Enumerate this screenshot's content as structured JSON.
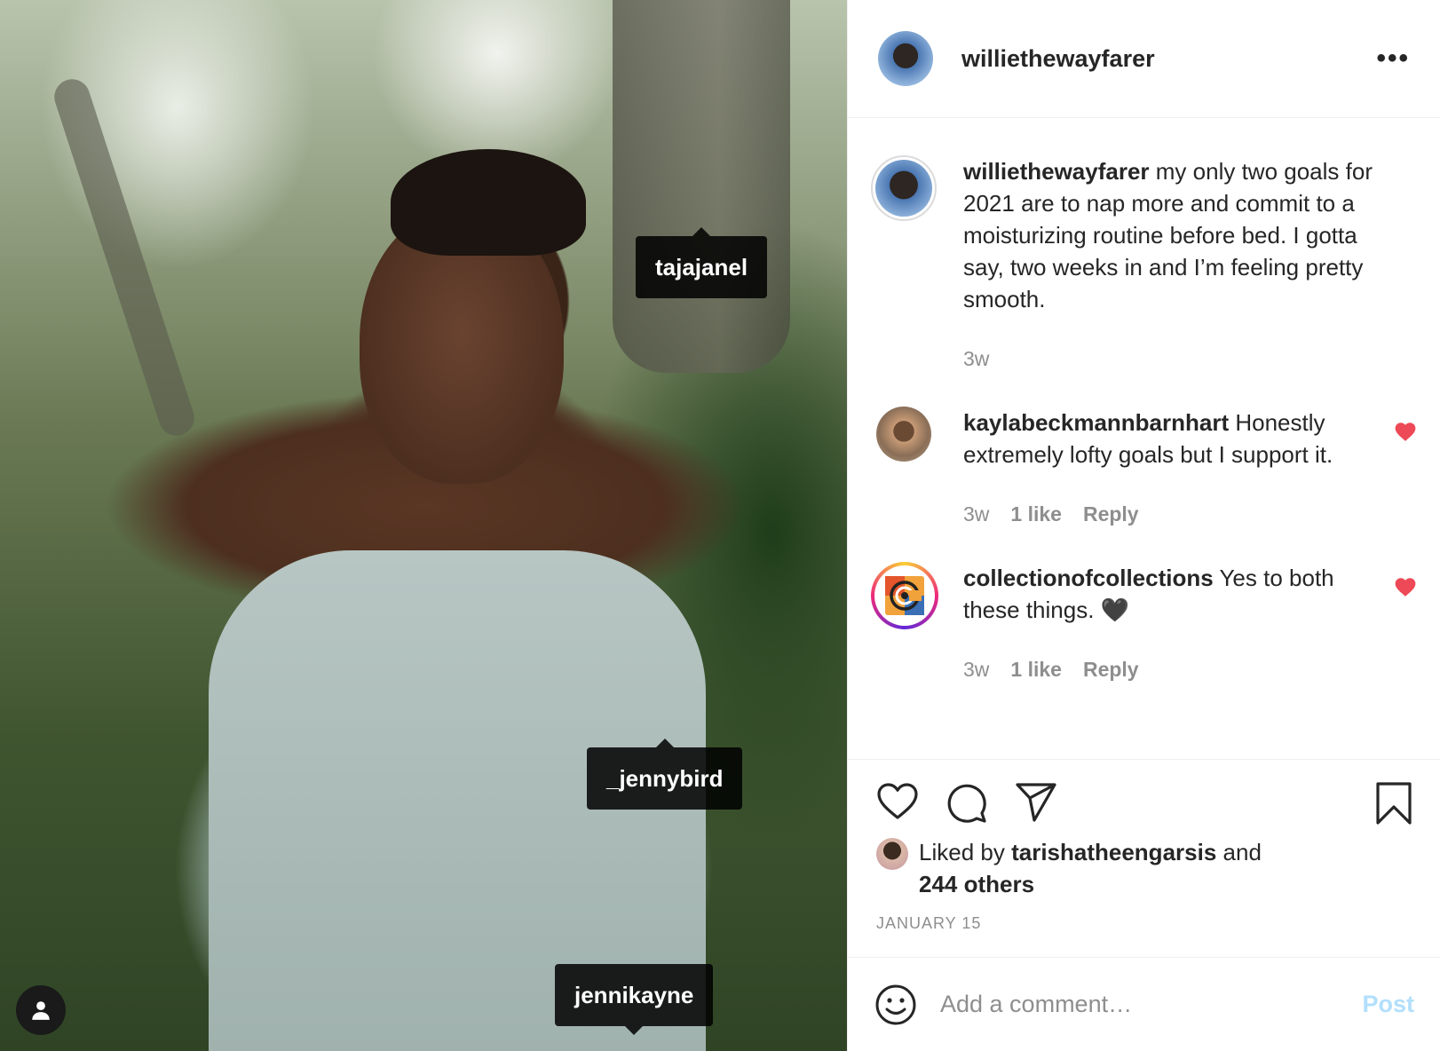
{
  "photo": {
    "tags": [
      {
        "label": "tajajanel"
      },
      {
        "label": "_jennybird"
      },
      {
        "label": "jennikayne"
      }
    ],
    "user_tags_icon": "person-icon"
  },
  "header": {
    "username": "williethewayfarer",
    "more_icon": "more-options-icon",
    "more_label": "•••"
  },
  "caption": {
    "username": "williethewayfarer",
    "text": " my only two goals for 2021 are to nap more and commit to a moisturizing routine before bed. I gotta say, two weeks in and I’m feeling pretty smooth.",
    "time": "3w"
  },
  "comments": [
    {
      "username": "kaylabeckmannbarnhart",
      "text": " Honestly extremely lofty goals but I support it.",
      "time": "3w",
      "likes": "1 like",
      "reply": "Reply",
      "liked": true
    },
    {
      "username": "collectionofcollections",
      "text": " Yes to both these things. 🖤",
      "time": "3w",
      "likes": "1 like",
      "reply": "Reply",
      "liked": true
    }
  ],
  "actions": {
    "icons": [
      "heart-icon",
      "comment-icon",
      "share-icon",
      "bookmark-icon"
    ]
  },
  "likes": {
    "prefix": "Liked by ",
    "user": "tarishatheengarsis",
    "middle": " and",
    "others": "244 others"
  },
  "date": "JANUARY 15",
  "add_comment": {
    "placeholder": "Add a comment…",
    "post_label": "Post"
  },
  "colors": {
    "heart_red": "#ed4956",
    "post_disabled_blue": "#b2dffc",
    "muted_text": "#8e8e8e"
  }
}
